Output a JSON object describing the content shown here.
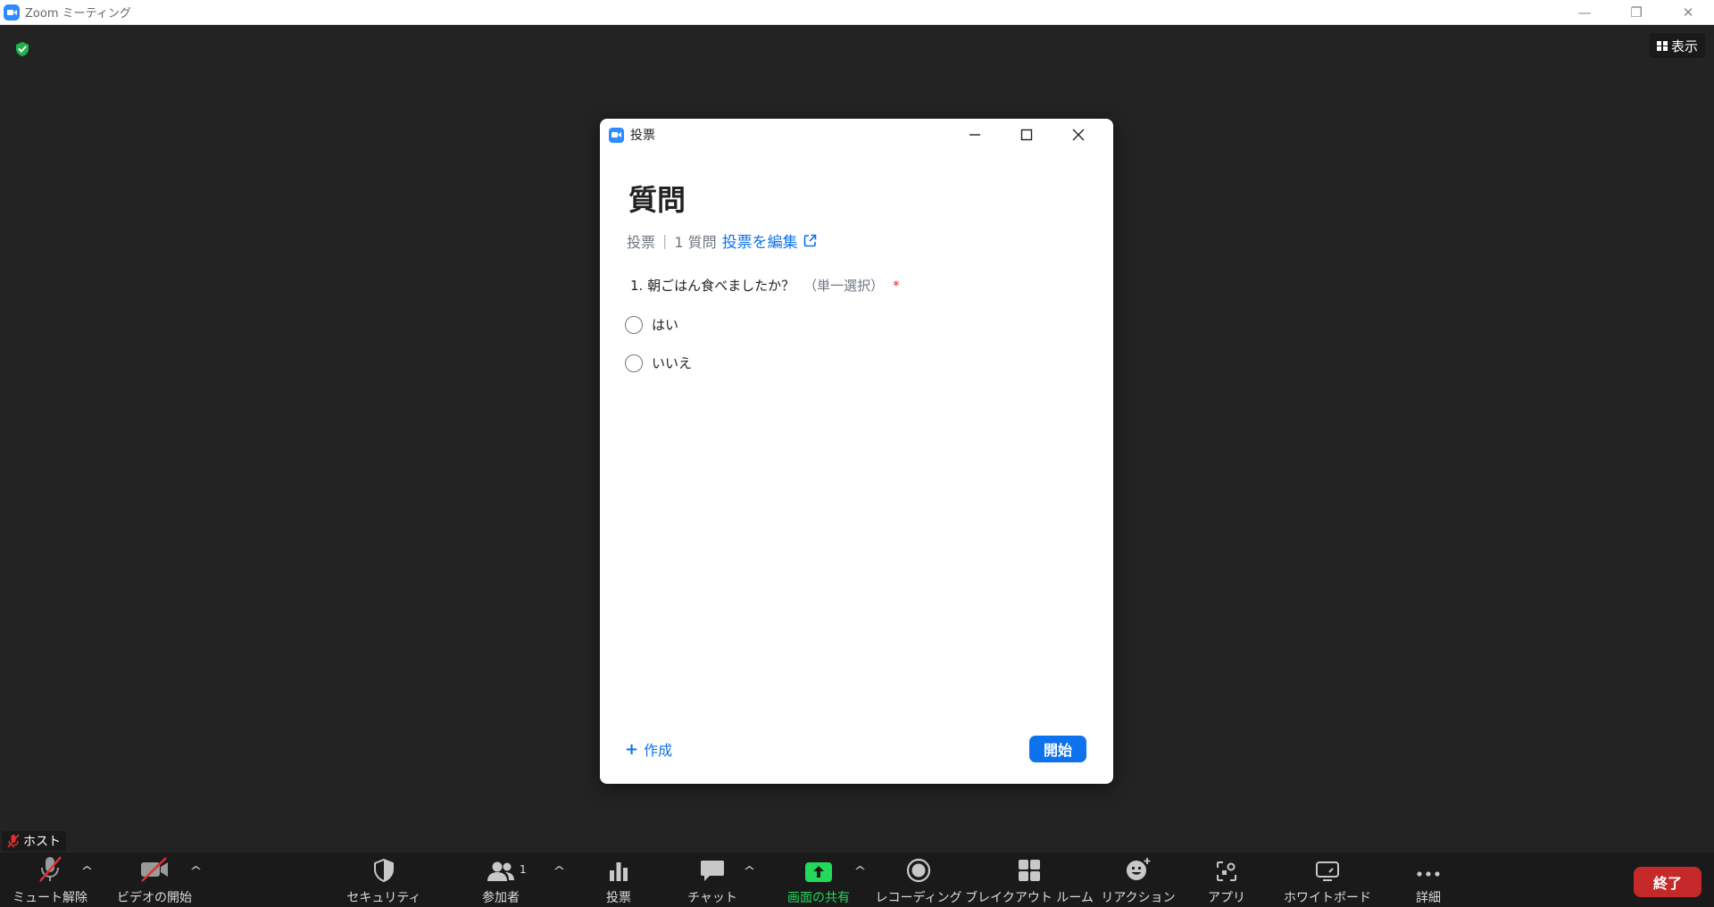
{
  "window": {
    "title": "Zoom ミーティング",
    "controls": [
      "—",
      "❐",
      "✕"
    ]
  },
  "meeting": {
    "view_label": "表示",
    "host_label": "ホスト"
  },
  "poll_dialog": {
    "title": "投票",
    "heading": "質問",
    "meta_type": "投票",
    "meta_sep": "|",
    "meta_count": "1 質問",
    "edit_label": "投票を編集",
    "question_text": "1. 朝ごはん食べましたか？",
    "question_type": "（単一選択）",
    "required_mark": "*",
    "options": [
      "はい",
      "いいえ"
    ],
    "create_label": "作成",
    "start_label": "開始"
  },
  "toolbar": {
    "mute": "ミュート解除",
    "video": "ビデオの開始",
    "security": "セキュリティ",
    "participants": "参加者",
    "participant_count": "1",
    "polls": "投票",
    "chat": "チャット",
    "share": "画面の共有",
    "record": "レコーディング",
    "breakout": "ブレイクアウト ルーム",
    "reactions": "リアクション",
    "apps": "アプリ",
    "whiteboard": "ホワイトボード",
    "more": "詳細",
    "end": "終了",
    "caret": "^"
  },
  "colors": {
    "accent": "#0e72ed",
    "share_green": "#23d959",
    "end_red": "#c62929",
    "background": "#232323",
    "toolbar": "#1a1a1a"
  }
}
